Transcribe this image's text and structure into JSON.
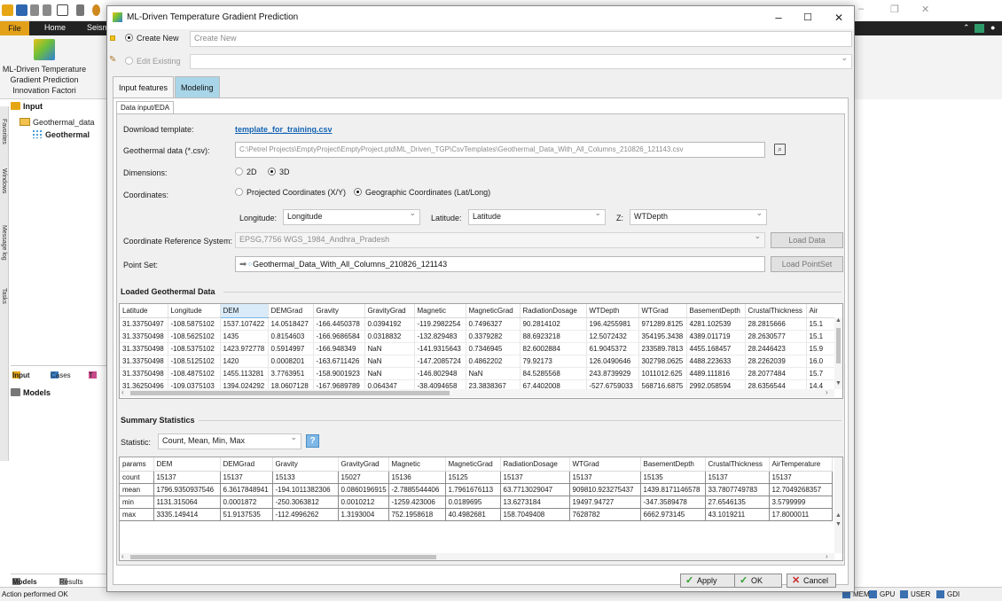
{
  "colors": {
    "ribbon_dark": "#222222",
    "file_tab": "#e3a11a",
    "active_tab": "#a9d5e8",
    "link": "#1464b4",
    "ok_check": "#2e9a2e",
    "cancel_x": "#c62828"
  },
  "host": {
    "ribbon_tabs": [
      "File",
      "Home",
      "Seism"
    ],
    "plugin_label": [
      "ML-Driven Temperature",
      "Gradient Prediction",
      "Innovation Factori"
    ],
    "side_labels": [
      "Favorites",
      "Windows",
      "Message log",
      "Tasks"
    ],
    "input_panel_title": "Input",
    "tree": {
      "folder": "Geothermal_data",
      "child": "Geothermal"
    },
    "panel_tabs": [
      "Input",
      "Cases",
      "T"
    ],
    "models_title": "Models",
    "bottom_tabs": [
      "Models",
      "Results"
    ],
    "status_message": "Action performed OK",
    "status_indicators": [
      "MEM",
      "GPU",
      "USER",
      "GDI"
    ]
  },
  "dialog": {
    "title": "ML-Driven Temperature Gradient Prediction",
    "window_controls": {
      "minimize": "–",
      "maximize": "☐",
      "close": "✕"
    },
    "create_new": {
      "label": "Create New",
      "placeholder": "Create New"
    },
    "edit_existing": {
      "label": "Edit Existing",
      "value": ""
    },
    "tabs": [
      "Input features",
      "Modeling"
    ],
    "subtab": "Data input/EDA",
    "form": {
      "download_template_label": "Download template:",
      "download_template_link": "template_for_training.csv",
      "geo_data_label": "Geothermal data (*.csv):",
      "geo_data_path": "C:\\Petrel Projects\\EmptyProject\\EmptyProject.ptd\\ML_Driven_TGP\\CsvTemplates\\Geothermal_Data_With_All_Columns_210826_121143.csv",
      "dimensions_label": "Dimensions:",
      "dim_2d": "2D",
      "dim_3d": "3D",
      "coordinates_label": "Coordinates:",
      "coord_projected": "Projected Coordinates (X/Y)",
      "coord_geographic": "Geographic Coordinates (Lat/Long)",
      "longitude_label": "Longitude:",
      "longitude_value": "Longitude",
      "latitude_label": "Latitude:",
      "latitude_value": "Latitude",
      "z_label": "Z:",
      "z_value": "WTDepth",
      "crs_label": "Coordinate Reference System:",
      "crs_value": "EPSG,7756 WGS_1984_Andhra_Pradesh",
      "load_data_button": "Load Data",
      "point_set_label": "Point Set:",
      "point_set_value": "Geothermal_Data_With_All_Columns_210826_121143",
      "load_pointset_button": "Load PointSet"
    },
    "loaded_title": "Loaded Geothermal Data",
    "loaded_columns": [
      "Latitude",
      "Longitude",
      "DEM",
      "DEMGrad",
      "Gravity",
      "GravityGrad",
      "Magnetic",
      "MagneticGrad",
      "RadiationDosage",
      "WTDepth",
      "WTGrad",
      "BasementDepth",
      "CrustalThickness",
      "Air"
    ],
    "loaded_rows": [
      [
        "31.33750497",
        "-108.5875102",
        "1537.107422",
        "14.0518427",
        "-166.4450378",
        "0.0394192",
        "-119.2982254",
        "0.7496327",
        "90.2814102",
        "196.4255981",
        "971289.8125",
        "4281.102539",
        "28.2815666",
        "15.1"
      ],
      [
        "31.33750498",
        "-108.5625102",
        "1435",
        "0.8154603",
        "-166.9686584",
        "0.0318832",
        "-132.829483",
        "0.3379282",
        "88.6923218",
        "12.5072432",
        "354195.3438",
        "4389.011719",
        "28.2630577",
        "15.1"
      ],
      [
        "31.33750498",
        "-108.5375102",
        "1423.972778",
        "0.5914997",
        "-166.948349",
        "NaN",
        "-141.9315643",
        "0.7346945",
        "82.6002884",
        "61.9045372",
        "233589.7813",
        "4455.168457",
        "28.2446423",
        "15.9"
      ],
      [
        "31.33750498",
        "-108.5125102",
        "1420",
        "0.0008201",
        "-163.6711426",
        "NaN",
        "-147.2085724",
        "0.4862202",
        "79.92173",
        "126.0490646",
        "302798.0625",
        "4488.223633",
        "28.2262039",
        "16.0"
      ],
      [
        "31.33750498",
        "-108.4875102",
        "1455.113281",
        "3.7763951",
        "-158.9001923",
        "NaN",
        "-146.802948",
        "NaN",
        "84.5285568",
        "243.8739929",
        "1011012.625",
        "4489.111816",
        "28.2077484",
        "15.7"
      ],
      [
        "31.36250496",
        "-109.0375103",
        "1394.024292",
        "18.0607128",
        "-167.9689789",
        "0.064347",
        "-38.4094658",
        "23.3838367",
        "67.4402008",
        "-527.6759033",
        "568716.6875",
        "2992.058594",
        "28.6356544",
        "14.4"
      ]
    ],
    "summary_title": "Summary Statistics",
    "statistic_label": "Statistic:",
    "statistic_value": "Count, Mean, Min, Max",
    "summary_columns": [
      "params",
      "DEM",
      "DEMGrad",
      "Gravity",
      "GravityGrad",
      "Magnetic",
      "MagneticGrad",
      "RadiationDosage",
      "WTGrad",
      "BasementDepth",
      "CrustalThickness",
      "AirTemperature"
    ],
    "summary_rows": [
      [
        "count",
        "15137",
        "15137",
        "15133",
        "15027",
        "15136",
        "15125",
        "15137",
        "15137",
        "15135",
        "15137",
        "15137"
      ],
      [
        "mean",
        "1796.9350937546",
        "6.3617848941",
        "-194.1011382306",
        "0.0860196915",
        "-2.7885544406",
        "1.7961676113",
        "63.7713029047",
        "909810.923275437",
        "1439.8171146578",
        "33.7807749783",
        "12.7049268357"
      ],
      [
        "min",
        "1131.315064",
        "0.0001872",
        "-250.3063812",
        "0.0010212",
        "-1259.423006",
        "0.0189695",
        "13.6273184",
        "19497.94727",
        "-347.3589478",
        "27.6546135",
        "3.5799999"
      ],
      [
        "max",
        "3335.149414",
        "51.9137535",
        "-112.4996262",
        "1.3193004",
        "752.1958618",
        "40.4982681",
        "158.7049408",
        "7628782",
        "6662.973145",
        "43.1019211",
        "17.8000011"
      ]
    ],
    "buttons": {
      "apply": "Apply",
      "ok": "OK",
      "cancel": "Cancel"
    }
  }
}
